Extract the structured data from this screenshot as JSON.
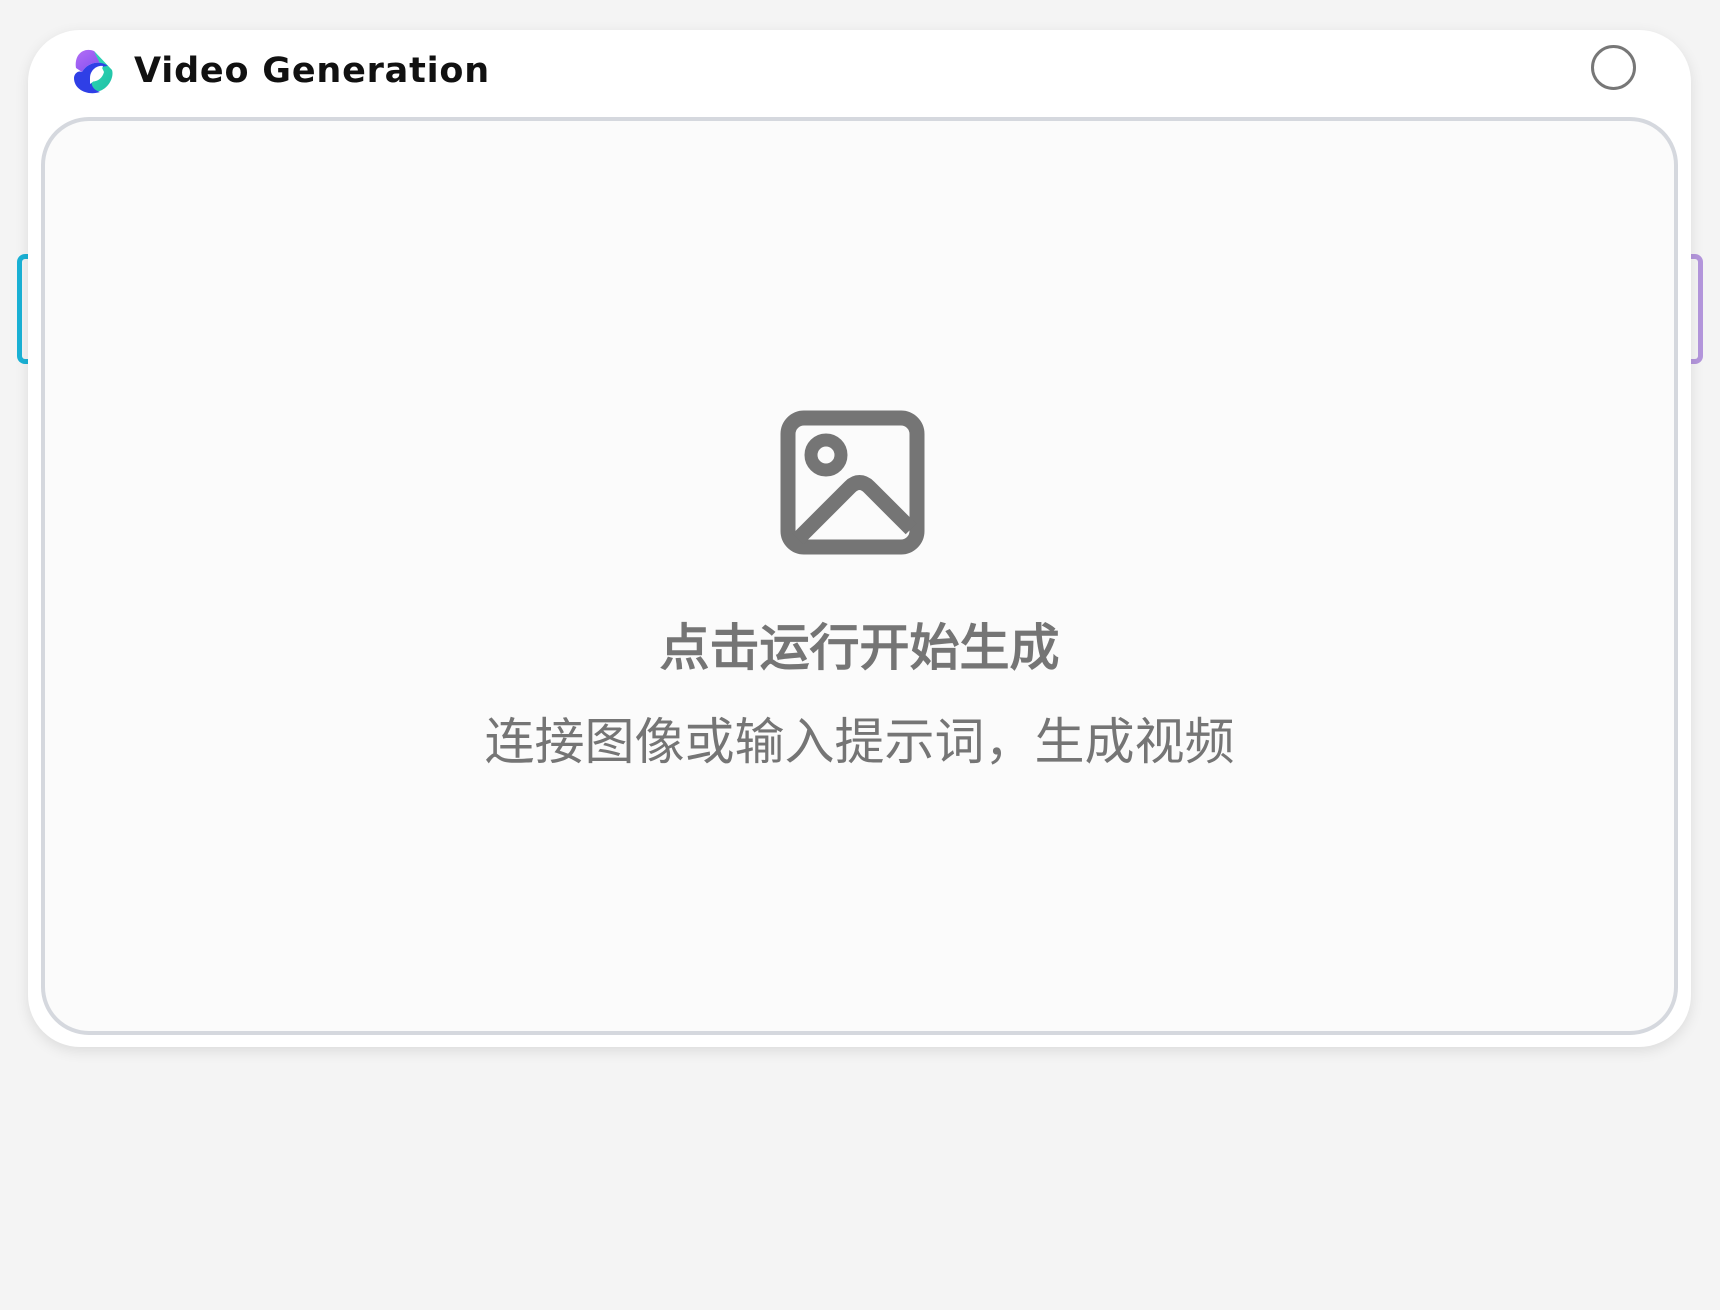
{
  "node": {
    "title": "Video Generation",
    "logo_icon": "app-logo-icon",
    "status_icon": "status-circle-icon"
  },
  "preview": {
    "icon": "image-placeholder-icon",
    "title": "点击运行开始生成",
    "subtitle": "连接图像或输入提示词，生成视频"
  },
  "ports": {
    "input_color": "#1ab2d6",
    "output_color": "#b496dc"
  },
  "colors": {
    "preview_border": "#d5d8de",
    "placeholder_text": "#757575",
    "logo_purple": "#9b5cf6",
    "logo_blue": "#2f3fe6",
    "logo_teal": "#2ed6b0"
  }
}
